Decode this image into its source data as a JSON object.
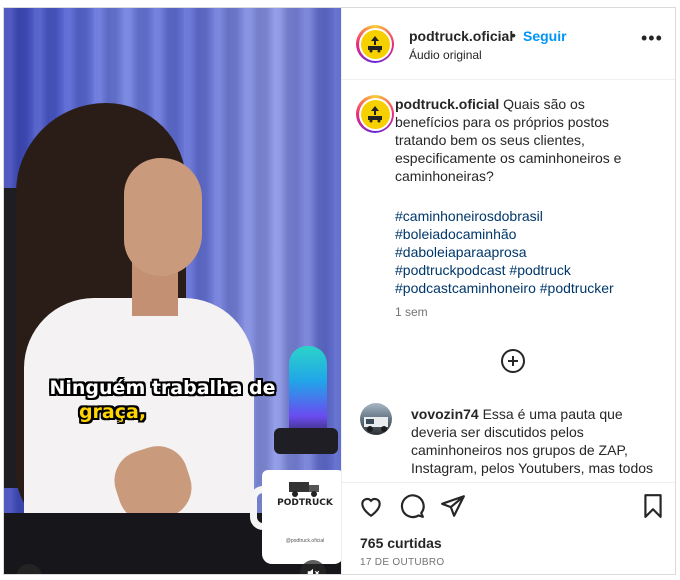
{
  "post": {
    "username": "podtruck.oficial",
    "separator": "•",
    "follow_label": "Seguir",
    "audio_label": "Áudio original",
    "more_icon": "more-options-icon"
  },
  "avatar": {
    "logo_text": "PODTRUCK",
    "ring_colors": [
      "#f9ce34",
      "#ee2a7b",
      "#6228d7"
    ],
    "logo_color": "#f7d000"
  },
  "video": {
    "caption_line1": "Ninguém trabalha de",
    "caption_line2": "graça,",
    "caption_highlight_color": "#ffd400",
    "mug_brand": "PODTRUCK",
    "mug_handle": "@podtruck.oficial",
    "mute_icon": "muted-speaker-icon"
  },
  "caption": {
    "username": "podtruck.oficial",
    "text": "Quais são os benefícios para os próprios postos tratando bem os seus clientes, especificamente os caminhoneiros e caminhoneiras?",
    "hashtags": [
      "#caminhoneirosdobrasil",
      "#boleiadocaminhão",
      "#daboleiaparaaprosa",
      "#podtruckpodcast #podtruck",
      "#podcastcaminhoneiro #podtrucker"
    ],
    "time": "1 sem"
  },
  "load_more_icon": "plus-circle-icon",
  "comments": [
    {
      "username": "vovozin74",
      "text": "Essa é uma pauta que deveria ser discutidos pelos caminhoneiros nos grupos de ZAP, Instagram, pelos Youtubers, mas todos preferem discutir"
    }
  ],
  "actions": {
    "likes": "765 curtidas",
    "date": "17 DE OUTUBRO"
  },
  "colors": {
    "link": "#0095f6",
    "hashtag": "#00376b",
    "muted_text": "#737373",
    "text": "#262626"
  }
}
